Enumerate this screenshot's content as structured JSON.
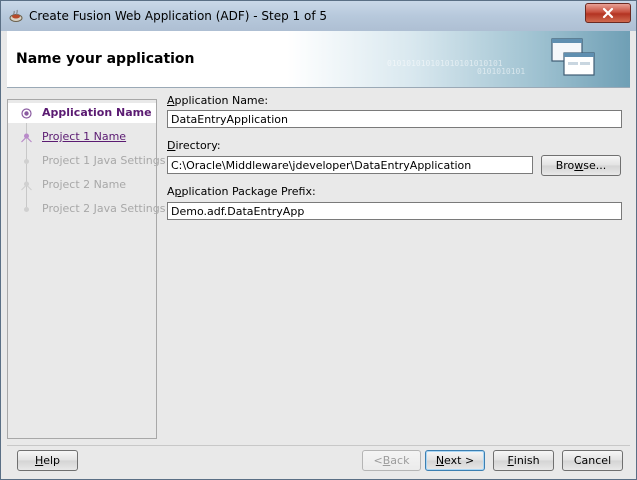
{
  "window": {
    "title": "Create Fusion Web Application (ADF) - Step 1 of 5"
  },
  "header": {
    "title": "Name your application",
    "binary_text_1": "010101010101010101010101",
    "binary_text_2": "0101010101"
  },
  "nav": {
    "items": [
      {
        "label": "Application Name",
        "state": "active"
      },
      {
        "label": "Project 1 Name",
        "state": "link"
      },
      {
        "label": "Project 1 Java Settings",
        "state": "disabled"
      },
      {
        "label": "Project 2 Name",
        "state": "disabled"
      },
      {
        "label": "Project 2 Java Settings",
        "state": "disabled"
      }
    ]
  },
  "form": {
    "app_name": {
      "label_mnemonic": "A",
      "label_rest": "pplication Name:",
      "value": "DataEntryApplication"
    },
    "directory": {
      "label_mnemonic": "D",
      "label_rest": "irectory:",
      "value": "C:\\Oracle\\Middleware\\jdeveloper\\DataEntryApplication"
    },
    "package_prefix": {
      "label_first": "A",
      "label_mnemonic": "p",
      "label_rest": "plication Package Prefix:",
      "value": "Demo.adf.DataEntryApp"
    },
    "browse": {
      "label_pre": "Bro",
      "label_mnemonic": "w",
      "label_post": "se..."
    }
  },
  "footer": {
    "help": {
      "label_mnemonic": "H",
      "label_rest": "elp"
    },
    "back": {
      "label_pre": "< ",
      "label_mnemonic": "B",
      "label_post": "ack"
    },
    "next": {
      "label_mnemonic": "N",
      "label_rest": "ext >"
    },
    "finish": {
      "label_mnemonic": "F",
      "label_rest": "inish"
    },
    "cancel": {
      "label": "Cancel"
    }
  },
  "colors": {
    "nav_active": "#5b1b72",
    "nav_disabled": "#a8a8a8",
    "close_button": "#c7503f"
  }
}
